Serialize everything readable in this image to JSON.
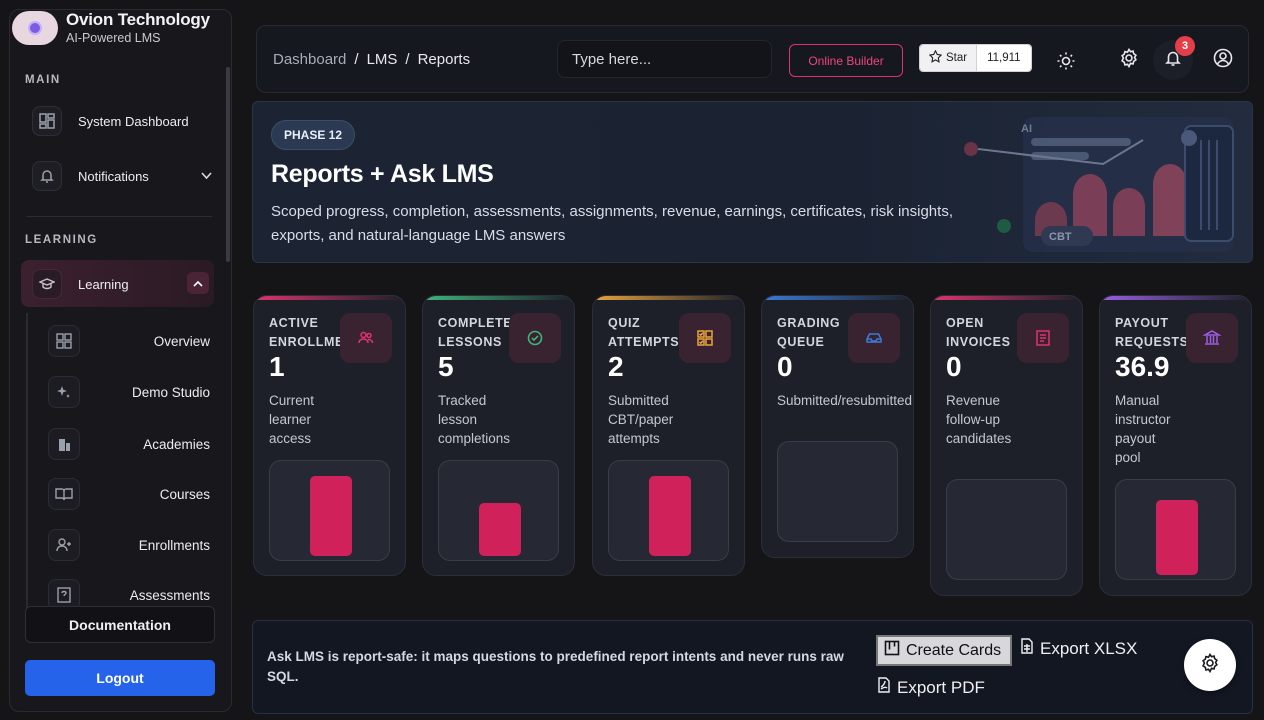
{
  "brand": {
    "title": "Ovion Technology",
    "subtitle": "AI-Powered LMS"
  },
  "sidebar": {
    "main_label": "MAIN",
    "learning_label": "LEARNING",
    "main_items": [
      {
        "label": "System Dashboard",
        "icon": "dashboard-icon"
      },
      {
        "label": "Notifications",
        "icon": "bell-icon"
      }
    ],
    "learning_item": {
      "label": "Learning",
      "icon": "graduation-cap-icon"
    },
    "sub_items": [
      {
        "label": "Overview",
        "icon": "grid-icon"
      },
      {
        "label": "Demo Studio",
        "icon": "sparkles-icon"
      },
      {
        "label": "Academies",
        "icon": "building-icon"
      },
      {
        "label": "Courses",
        "icon": "book-open-icon"
      },
      {
        "label": "Enrollments",
        "icon": "user-plus-icon"
      },
      {
        "label": "Assessments",
        "icon": "quiz-icon"
      }
    ],
    "documentation_label": "Documentation",
    "logout_label": "Logout"
  },
  "topbar": {
    "breadcrumb": [
      "Dashboard",
      "LMS",
      "Reports"
    ],
    "search_placeholder": "Type here...",
    "online_builder_label": "Online Builder",
    "star_label": "Star",
    "star_count": "11,911",
    "notification_count": "3"
  },
  "hero": {
    "phase": "PHASE 12",
    "title": "Reports + Ask LMS",
    "description": "Scoped progress, completion, assessments, assignments, revenue, earnings, certificates, risk insights, exports, and natural-language LMS answers",
    "deco_ai": "AI",
    "deco_cbt": "CBT"
  },
  "cards": [
    {
      "label": "ACTIVE ENROLLMENTS",
      "value": "1",
      "desc": "Current learner access",
      "accent": "#e0336e",
      "icon": "users-icon",
      "fill": 0.9
    },
    {
      "label": "COMPLETED LESSONS",
      "value": "5",
      "desc": "Tracked lesson completions",
      "accent": "#3fb57a",
      "icon": "check-circle-icon",
      "fill": 0.6
    },
    {
      "label": "QUIZ ATTEMPTS",
      "value": "2",
      "desc": "Submitted CBT/paper attempts",
      "accent": "#e8a43a",
      "icon": "checklist-icon",
      "fill": 0.9
    },
    {
      "label": "GRADING QUEUE",
      "value": "0",
      "desc": "Submitted/resubmitted assignments",
      "accent": "#3a7bd8",
      "icon": "inbox-icon",
      "fill": 0
    },
    {
      "label": "OPEN INVOICES",
      "value": "0",
      "desc": "Revenue follow-up candidates",
      "accent": "#e0336e",
      "icon": "receipt-icon",
      "fill": 0
    },
    {
      "label": "PAYOUT REQUESTS",
      "value": "36.9",
      "desc": "Manual instructor payout pool",
      "accent": "#9b5de5",
      "icon": "bank-icon",
      "fill": 0.84
    }
  ],
  "bottom": {
    "note": "Ask LMS is report-safe: it maps questions to predefined report intents and never runs raw SQL.",
    "create_cards_label": "Create Cards",
    "export_xlsx_label": "Export XLSX",
    "export_pdf_label": "Export PDF"
  }
}
